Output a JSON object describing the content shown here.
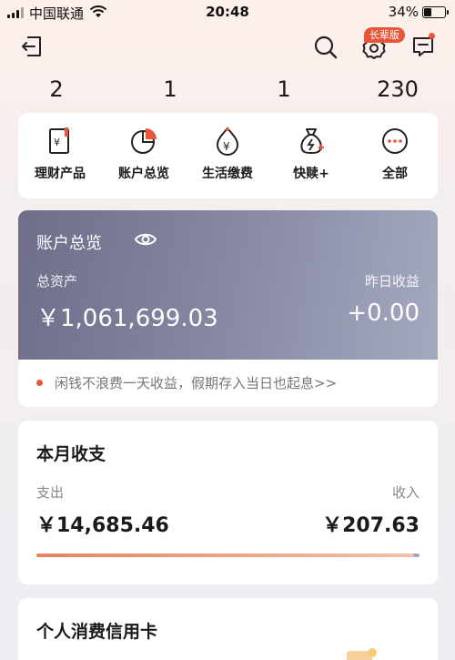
{
  "status_bar": {
    "carrier": "中国联通",
    "time": "20:48",
    "battery": "34%",
    "icons": [
      "signal-icon",
      "wifi-icon",
      "battery-icon"
    ]
  },
  "nav": {
    "elder_badge": "长辈版",
    "icons": [
      "back-icon",
      "search-icon",
      "gear-icon",
      "message-icon"
    ]
  },
  "counts": [
    "2",
    "1",
    "1",
    "230"
  ],
  "quick_actions": [
    {
      "label": "理财产品",
      "icon": "finance-product-icon"
    },
    {
      "label": "账户总览",
      "icon": "pie-chart-icon"
    },
    {
      "label": "生活缴费",
      "icon": "yen-drop-icon"
    },
    {
      "label": "快赎+",
      "icon": "money-bag-icon"
    },
    {
      "label": "全部",
      "icon": "more-icon"
    }
  ],
  "overview": {
    "title": "账户总览",
    "total_assets_label": "总资产",
    "total_assets_value": "￥1,061,699.03",
    "yesterday_label": "昨日收益",
    "yesterday_value": "+0.00"
  },
  "notice": {
    "text": "闲钱不浪费一天收益，假期存入当日也起息>>"
  },
  "monthly": {
    "title": "本月收支",
    "expense_label": "支出",
    "expense_value": "￥14,685.46",
    "income_label": "收入",
    "income_value": "￥207.63",
    "expense_ratio": 0.986
  },
  "credit": {
    "title": "个人消费信用卡"
  },
  "colors": {
    "accent": "#e8553b",
    "overview_gradient_start": "#6e6d8a",
    "overview_gradient_end": "#a3a9c0",
    "bar_expense": "#e8845e",
    "bar_income": "#9aa6c7"
  }
}
